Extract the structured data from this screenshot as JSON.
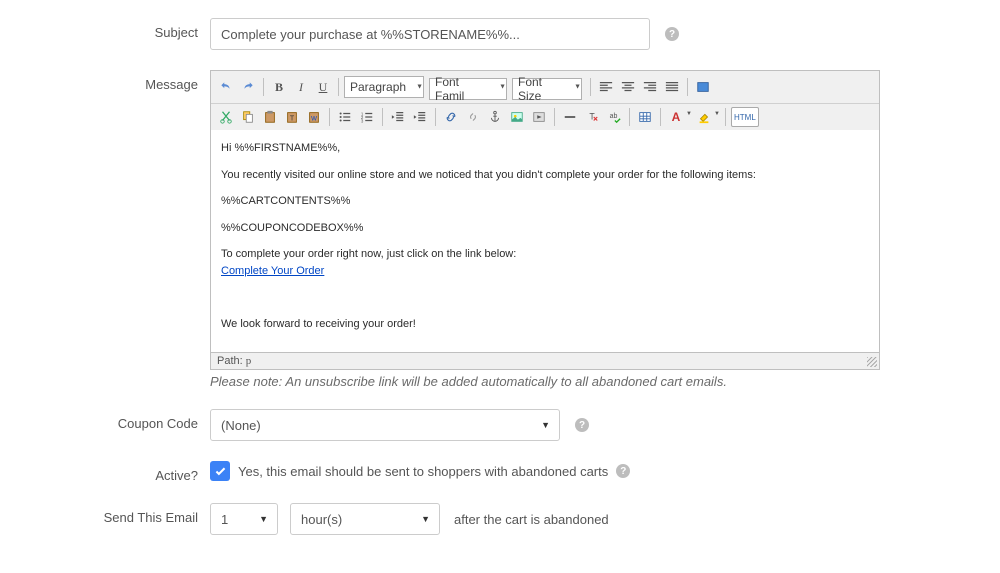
{
  "labels": {
    "subject": "Subject",
    "message": "Message",
    "coupon": "Coupon Code",
    "active": "Active?",
    "sendEmail": "Send This Email"
  },
  "subject": {
    "value": "Complete your purchase at %%STORENAME%%..."
  },
  "editor": {
    "formatSelect": "Paragraph",
    "fontFamilySelect": "Font Famil",
    "fontSizeSelect": "Font Size",
    "htmlBtn": "HTML",
    "body": {
      "line1": "Hi %%FIRSTNAME%%,",
      "line2": "You recently visited our online store and we noticed that you didn't complete your order for the following items:",
      "line3": "%%CARTCONTENTS%%",
      "line4": "%%COUPONCODEBOX%%",
      "line5": "To complete your order right now, just click on the link below:",
      "link": "Complete Your Order",
      "line6": "We look forward to receiving your order!"
    },
    "pathLabel": "Path:",
    "pathValue": "p"
  },
  "note": "Please note: An unsubscribe link will be added automatically to all abandoned cart emails.",
  "coupon": {
    "selected": "(None)"
  },
  "active": {
    "text": "Yes, this email should be sent to shoppers with abandoned carts"
  },
  "send": {
    "qty": "1",
    "unit": "hour(s)",
    "suffix": "after the cart is abandoned"
  }
}
